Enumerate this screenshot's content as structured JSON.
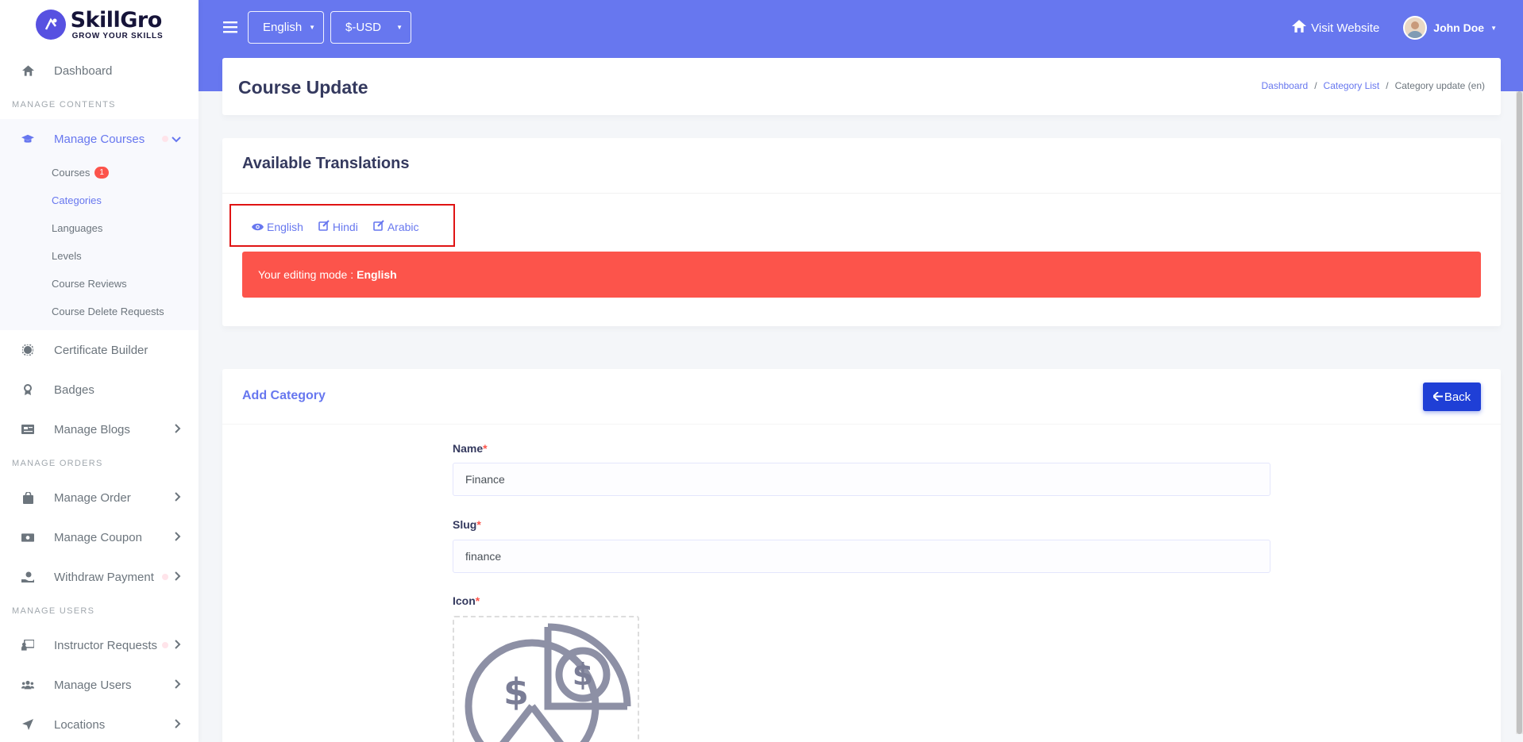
{
  "brand": {
    "name": "SkillGro",
    "tagline": "GROW YOUR SKILLS"
  },
  "sidebar": {
    "dashboard": "Dashboard",
    "section_contents": "MANAGE CONTENTS",
    "manage_courses": "Manage Courses",
    "sub_items": [
      {
        "label": "Courses",
        "badge": "1"
      },
      {
        "label": "Categories"
      },
      {
        "label": "Languages"
      },
      {
        "label": "Levels"
      },
      {
        "label": "Course Reviews"
      },
      {
        "label": "Course Delete Requests"
      }
    ],
    "certificate_builder": "Certificate Builder",
    "badges": "Badges",
    "manage_blogs": "Manage Blogs",
    "section_orders": "MANAGE ORDERS",
    "manage_order": "Manage Order",
    "manage_coupon": "Manage Coupon",
    "withdraw_payment": "Withdraw Payment",
    "section_users": "MANAGE USERS",
    "instructor_requests": "Instructor Requests",
    "manage_users": "Manage Users",
    "locations": "Locations"
  },
  "topbar": {
    "language": "English",
    "currency": "$-USD",
    "visit_website": "Visit Website",
    "user_name": "John Doe"
  },
  "header": {
    "title": "Course Update",
    "breadcrumb": [
      "Dashboard",
      "Category List",
      "Category update (en)"
    ]
  },
  "translations": {
    "title": "Available Translations",
    "languages": [
      "English",
      "Hindi",
      "Arabic"
    ],
    "alert_prefix": "Your editing mode :",
    "alert_lang": "English"
  },
  "form": {
    "title": "Add Category",
    "back_label": "Back",
    "name_label": "Name",
    "name_value": "Finance",
    "slug_label": "Slug",
    "slug_value": "finance",
    "icon_label": "Icon",
    "required_mark": "*"
  },
  "colors": {
    "primary": "#6777ef",
    "danger": "#fc544b",
    "back_button": "#1f3fd6"
  }
}
